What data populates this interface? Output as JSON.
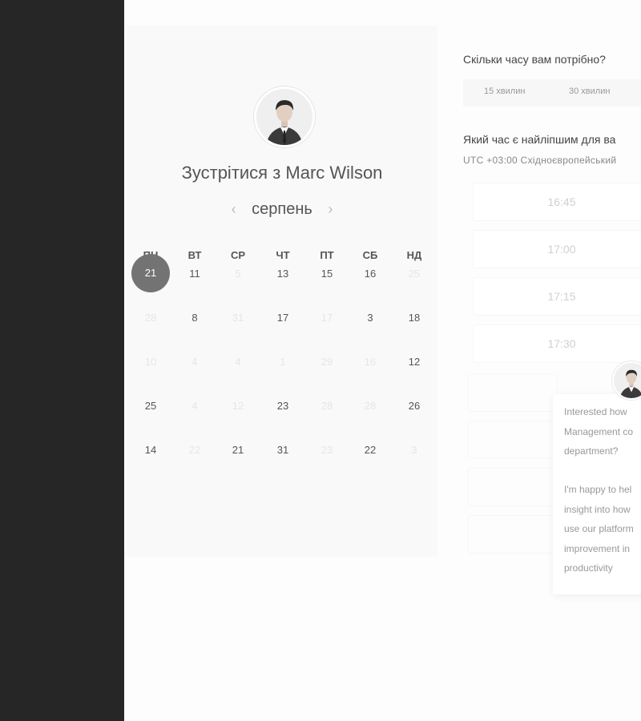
{
  "window": {
    "sidebar_color": "#262626",
    "accent": "#737373"
  },
  "host": {
    "meet_title": "Зустрітися з Marc Wilson",
    "avatar_icon": "person-photo"
  },
  "calendar": {
    "month": "серпень",
    "weekdays": [
      "ПН",
      "ВТ",
      "СР",
      "ЧТ",
      "ПТ",
      "СБ",
      "НД"
    ],
    "rows": [
      [
        "21",
        "11",
        "5",
        "13",
        "15",
        "16",
        "25"
      ],
      [
        "28",
        "8",
        "31",
        "17",
        "17",
        "3",
        "18"
      ],
      [
        "10",
        "4",
        "4",
        "1",
        "29",
        "16",
        "12"
      ],
      [
        "25",
        "4",
        "12",
        "23",
        "28",
        "28",
        "26"
      ],
      [
        "14",
        "22",
        "21",
        "31",
        "23",
        "22",
        "3"
      ]
    ],
    "selected_day": "21"
  },
  "duration": {
    "question": "Скільки часу вам потрібно?",
    "options": [
      "15 хвилин",
      "30 хвилин"
    ]
  },
  "time": {
    "question": "Який час є найліпшим для ва",
    "timezone": "UTC +03:00 Східноєвропейський",
    "slots": [
      "16:45",
      "17:00",
      "17:15",
      "17:30"
    ]
  },
  "chat": {
    "message_1": [
      "Interested how",
      "Management co",
      "department?"
    ],
    "message_2": [
      "I'm happy to hel",
      "insight into how",
      "use our platform",
      "improvement in",
      "productivity"
    ]
  }
}
